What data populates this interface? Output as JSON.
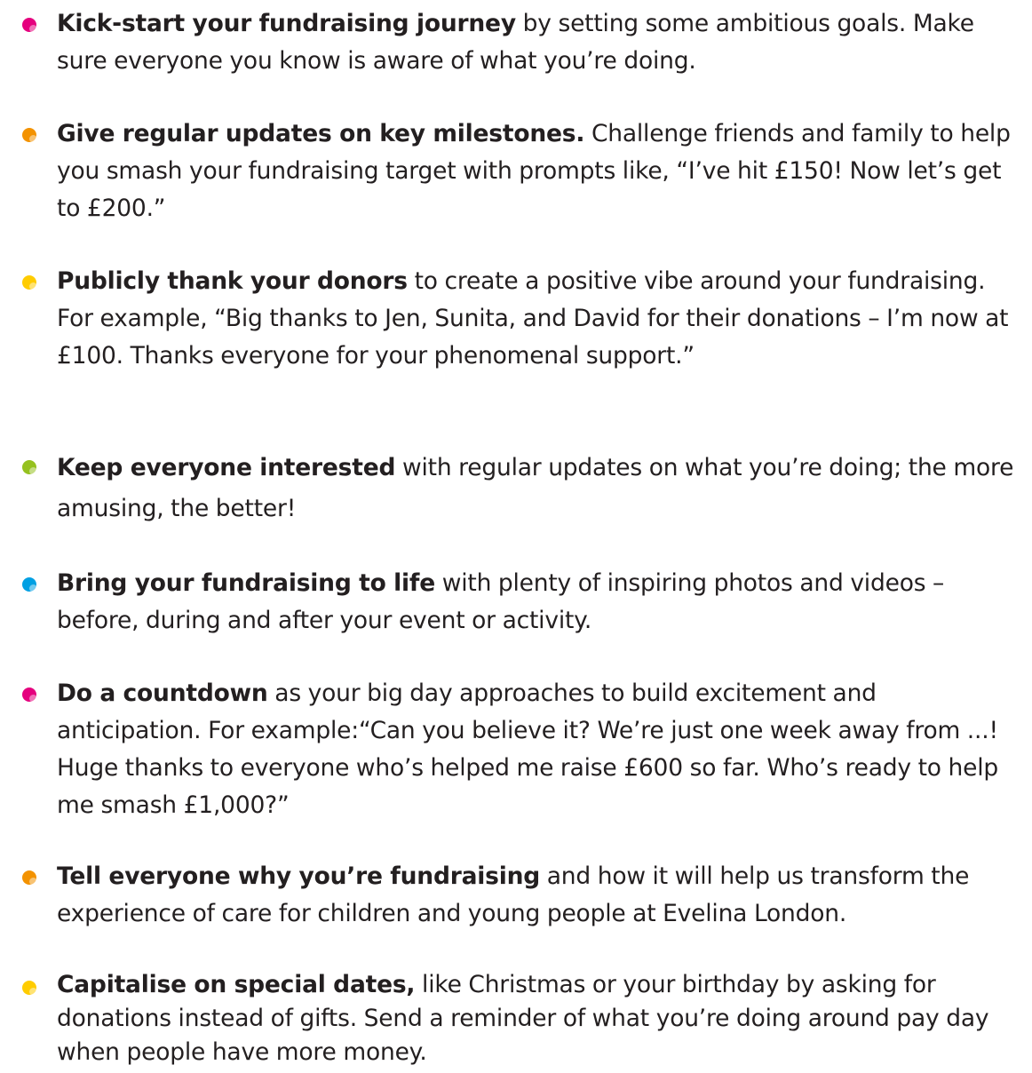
{
  "tips": [
    {
      "lead": "Kick-start your fundraising journey",
      "body": "  by setting some ambitious goals. Make sure everyone you know is aware of what you’re doing.",
      "bullet_color": "#e5007e"
    },
    {
      "lead": "Give regular updates on key milestones.",
      "body": " Challenge friends and family to help you smash your fundraising target with prompts like, “I’ve hit £150! Now let’s get to £200.”",
      "bullet_color": "#f39200"
    },
    {
      "lead": "Publicly thank your donors",
      "body": " to create a positive vibe around your fundraising. For example, “Big thanks to Jen, Sunita, and David for their donations – I’m now at £100. Thanks everyone for your phenomenal support.”",
      "bullet_color": "#ffcc00"
    },
    {
      "lead": "Keep everyone interested",
      "body": " with regular updates on what you’re doing; the more amusing, the better!",
      "bullet_color": "#95c11f"
    },
    {
      "lead": "Bring your fundraising to life",
      "body": " with plenty of inspiring photos and videos – before, during and after your event or activity.",
      "bullet_color": "#00a0e3"
    },
    {
      "lead": "Do a countdown",
      "body": "  as your big day approaches to build excitement and anticipation. For example:“Can you believe it? We’re just one week away from ...! Huge thanks to everyone who’s helped me raise £600 so far. Who’s ready to help me smash £1,000?”",
      "bullet_color": "#e5007e"
    },
    {
      "lead": "Tell everyone why you’re fundraising",
      "body": " and how it will help us transform the experience of care for children and young people at Evelina London.",
      "bullet_color": "#f39200"
    },
    {
      "lead": "Capitalise on special dates,",
      "body": " like Christmas or your birthday by asking for donations instead of gifts. Send a reminder of what you’re doing around pay day when people have more money.",
      "bullet_color": "#ffcc00"
    }
  ]
}
